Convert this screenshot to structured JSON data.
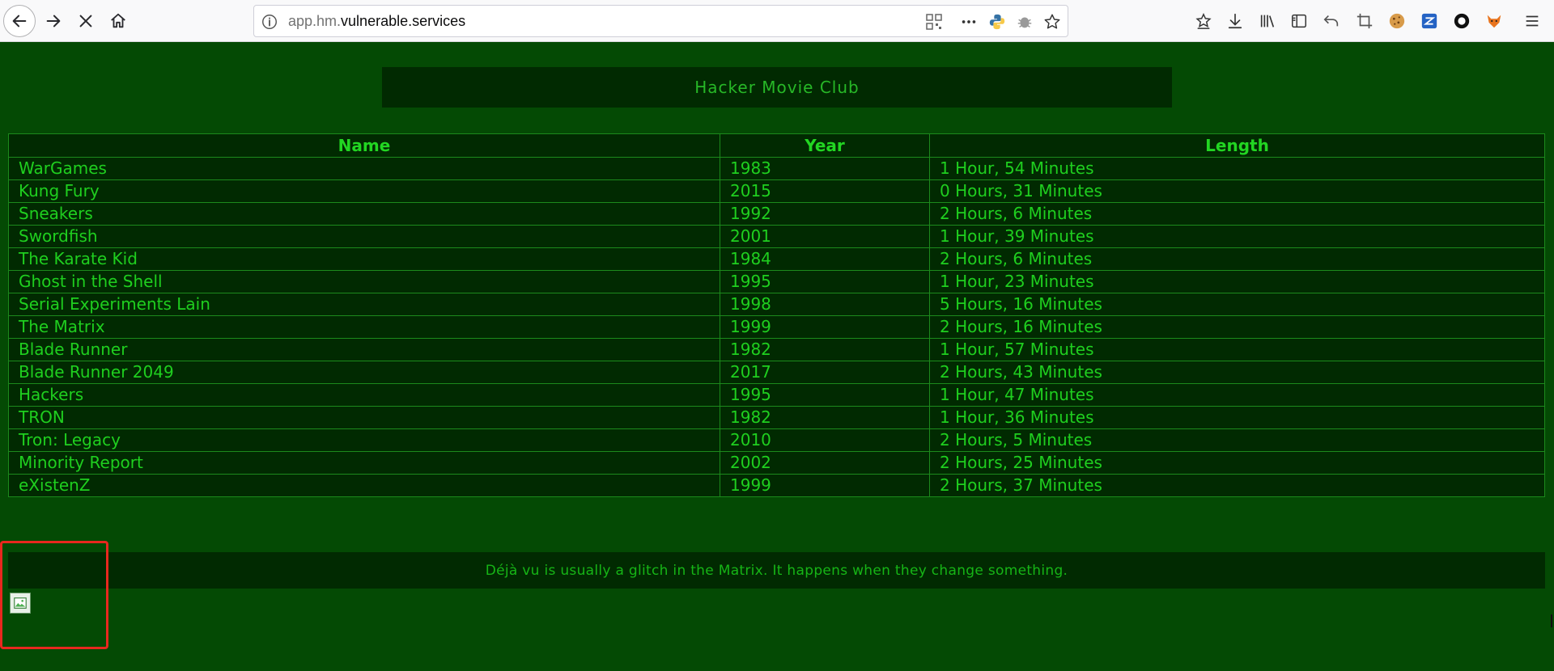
{
  "browser": {
    "url_prefix": "app.hm.",
    "url_domain": "vulnerable.services"
  },
  "page": {
    "title": "Hacker Movie Club",
    "table": {
      "columns": [
        "Name",
        "Year",
        "Length"
      ],
      "rows": [
        {
          "name": "WarGames",
          "year": "1983",
          "length": "1 Hour, 54 Minutes"
        },
        {
          "name": "Kung Fury",
          "year": "2015",
          "length": "0 Hours, 31 Minutes"
        },
        {
          "name": "Sneakers",
          "year": "1992",
          "length": "2 Hours, 6 Minutes"
        },
        {
          "name": "Swordfish",
          "year": "2001",
          "length": "1 Hour, 39 Minutes"
        },
        {
          "name": "The Karate Kid",
          "year": "1984",
          "length": "2 Hours, 6 Minutes"
        },
        {
          "name": "Ghost in the Shell",
          "year": "1995",
          "length": "1 Hour, 23 Minutes"
        },
        {
          "name": "Serial Experiments Lain",
          "year": "1998",
          "length": "5 Hours, 16 Minutes"
        },
        {
          "name": "The Matrix",
          "year": "1999",
          "length": "2 Hours, 16 Minutes"
        },
        {
          "name": "Blade Runner",
          "year": "1982",
          "length": "1 Hour, 57 Minutes"
        },
        {
          "name": "Blade Runner 2049",
          "year": "2017",
          "length": "2 Hours, 43 Minutes"
        },
        {
          "name": "Hackers",
          "year": "1995",
          "length": "1 Hour, 47 Minutes"
        },
        {
          "name": "TRON",
          "year": "1982",
          "length": "1 Hour, 36 Minutes"
        },
        {
          "name": "Tron: Legacy",
          "year": "2010",
          "length": "2 Hours, 5 Minutes"
        },
        {
          "name": "Minority Report",
          "year": "2002",
          "length": "2 Hours, 25 Minutes"
        },
        {
          "name": "eXistenZ",
          "year": "1999",
          "length": "2 Hours, 37 Minutes"
        }
      ]
    },
    "footer_text": "Déjà vu is usually a glitch in the Matrix. It happens when they change something."
  },
  "colors": {
    "page_background": "#044a04",
    "panel_background": "#012a01",
    "text_green": "#1fcf1f",
    "highlight": "#e8281e"
  }
}
